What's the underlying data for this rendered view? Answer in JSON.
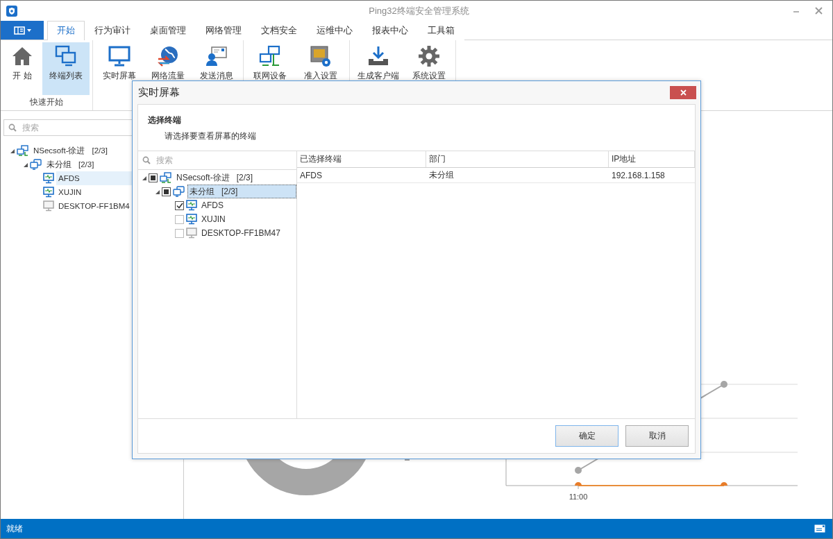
{
  "window": {
    "title": "Ping32终端安全管理系统"
  },
  "menu_tabs": [
    {
      "label": "开始",
      "selected": true
    },
    {
      "label": "行为审计",
      "selected": false
    },
    {
      "label": "桌面管理",
      "selected": false
    },
    {
      "label": "网络管理",
      "selected": false
    },
    {
      "label": "文档安全",
      "selected": false
    },
    {
      "label": "运维中心",
      "selected": false
    },
    {
      "label": "报表中心",
      "selected": false
    },
    {
      "label": "工具箱",
      "selected": false
    }
  ],
  "ribbon": {
    "groups": [
      {
        "label": "快速开始",
        "buttons": [
          {
            "label": "开 始",
            "selected": false
          },
          {
            "label": "终端列表",
            "selected": true
          }
        ]
      },
      {
        "buttons": [
          {
            "label": "实时屏幕",
            "selected": false
          },
          {
            "label": "网络流量",
            "selected": false
          },
          {
            "label": "发送消息",
            "selected": false
          }
        ]
      },
      {
        "buttons": [
          {
            "label": "联网设备",
            "selected": false
          },
          {
            "label": "准入设置",
            "selected": false
          }
        ]
      },
      {
        "buttons": [
          {
            "label": "生成客户端",
            "selected": false
          },
          {
            "label": "系统设置",
            "selected": false
          }
        ]
      }
    ]
  },
  "sidebar": {
    "search_placeholder": "搜索",
    "tree": [
      {
        "kind": "domain",
        "label": "NSecsoft-徐进",
        "count": "[2/3]",
        "expanded": true,
        "selected": false,
        "children": [
          {
            "kind": "group",
            "label": "未分组",
            "count": "[2/3]",
            "expanded": true,
            "selected": false,
            "children": [
              {
                "kind": "terminal",
                "label": "AFDS",
                "online": true,
                "selected": true
              },
              {
                "kind": "terminal",
                "label": "XUJIN",
                "online": true,
                "selected": false
              },
              {
                "kind": "terminal",
                "label": "DESKTOP-FF1BM4",
                "online": false,
                "selected": false
              }
            ]
          }
        ]
      }
    ]
  },
  "dashboard": {
    "tick_label": "11:00"
  },
  "dialog": {
    "title": "实时屏幕",
    "heading": "选择终端",
    "subtitle": "请选择要查看屏幕的终端",
    "search_placeholder": "搜索",
    "tree": [
      {
        "kind": "domain",
        "label": "NSecsoft-徐进",
        "count": "[2/3]",
        "expanded": true,
        "checked": false,
        "partial": true,
        "selected": false,
        "children": [
          {
            "kind": "group",
            "label": "未分组",
            "count": "[2/3]",
            "expanded": true,
            "checked": false,
            "partial": true,
            "selected": true,
            "children": [
              {
                "kind": "terminal",
                "label": "AFDS",
                "online": true,
                "checked": true,
                "partial": false,
                "selected": false
              },
              {
                "kind": "terminal",
                "label": "XUJIN",
                "online": true,
                "checked": false,
                "partial": false,
                "selected": false
              },
              {
                "kind": "terminal",
                "label": "DESKTOP-FF1BM47",
                "online": false,
                "checked": false,
                "partial": false,
                "selected": false
              }
            ]
          }
        ]
      }
    ],
    "table": {
      "columns": [
        "已选择终端",
        "部门",
        "IP地址"
      ],
      "rows": [
        [
          "AFDS",
          "未分组",
          "192.168.1.158"
        ]
      ]
    },
    "buttons": [
      {
        "label": "确定",
        "default": true
      },
      {
        "label": "取消",
        "default": false
      }
    ]
  },
  "status_bar": {
    "text": "就绪"
  }
}
